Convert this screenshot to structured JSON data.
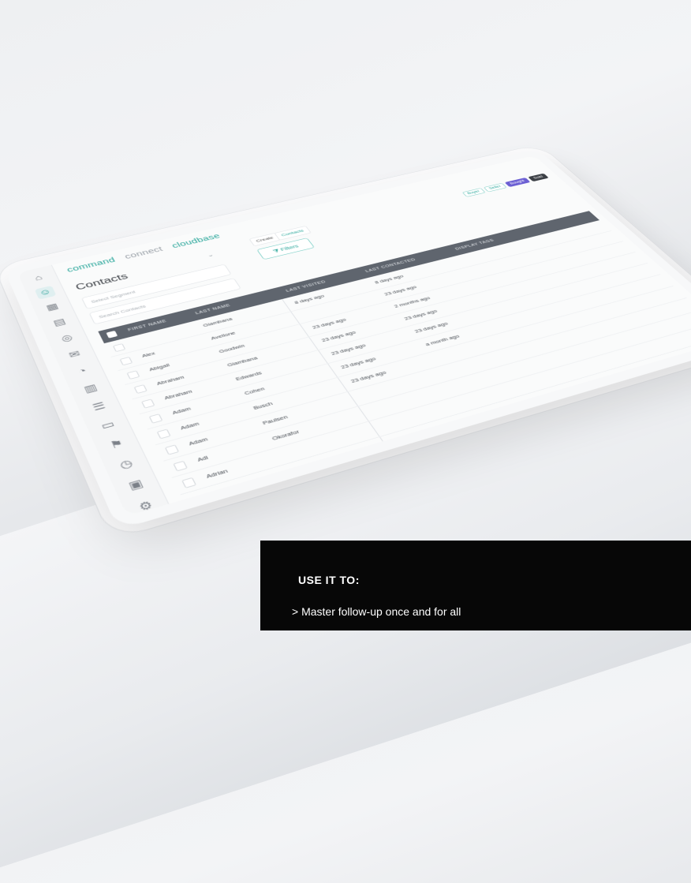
{
  "brand": {
    "part1": "command",
    "part2": "connect",
    "part3": "cloudbase"
  },
  "page": {
    "title": "Contacts"
  },
  "search": {
    "select_placeholder": "Select Segment",
    "contacts_placeholder": "Search Contacts"
  },
  "toolbar": {
    "chip_a": "Create",
    "chip_b": "Contacts",
    "filter_label": "Filters",
    "filter_icon": "filter-icon"
  },
  "tags": [
    "Buyer",
    "Seller",
    "Bought",
    "Sold"
  ],
  "table": {
    "headers": [
      "FIRST NAME",
      "LAST NAME",
      "LAST VISITED",
      "LAST CONTACTED",
      "DISPLAY TAGS"
    ],
    "rows": [
      {
        "first": "",
        "last": "Giambana",
        "visited": "8 days ago",
        "contacted": "8 days ago"
      },
      {
        "first": "Alex",
        "last": "Avellone",
        "visited": "",
        "contacted": "23 days ago"
      },
      {
        "first": "Abigail",
        "last": "Goodwin",
        "visited": "23 days ago",
        "contacted": "2 months ago"
      },
      {
        "first": "Abraham",
        "last": "Giambana",
        "visited": "23 days ago",
        "contacted": "23 days ago"
      },
      {
        "first": "Abraham",
        "last": "Edwards",
        "visited": "23 days ago",
        "contacted": "23 days ago"
      },
      {
        "first": "Adam",
        "last": "Cohen",
        "visited": "23 days ago",
        "contacted": "a month ago"
      },
      {
        "first": "Adam",
        "last": "Busch",
        "visited": "23 days ago",
        "contacted": ""
      },
      {
        "first": "Adam",
        "last": "Paulsen",
        "visited": "",
        "contacted": ""
      },
      {
        "first": "Adi",
        "last": "Okorafor",
        "visited": "",
        "contacted": ""
      },
      {
        "first": "Adrian",
        "last": "",
        "visited": "",
        "contacted": ""
      }
    ]
  },
  "sidebar": {
    "icons": [
      "home-icon",
      "contacts-icon",
      "grid-icon",
      "calendar-icon",
      "settings-icon",
      "mail-icon",
      "chart-icon",
      "bar-chart-icon",
      "list-icon",
      "folder-icon",
      "flag-icon",
      "clock-icon",
      "card-icon",
      "gear-icon"
    ]
  },
  "caption": {
    "heading": "USE IT TO:",
    "line1": "> Master follow-up once and for all"
  }
}
